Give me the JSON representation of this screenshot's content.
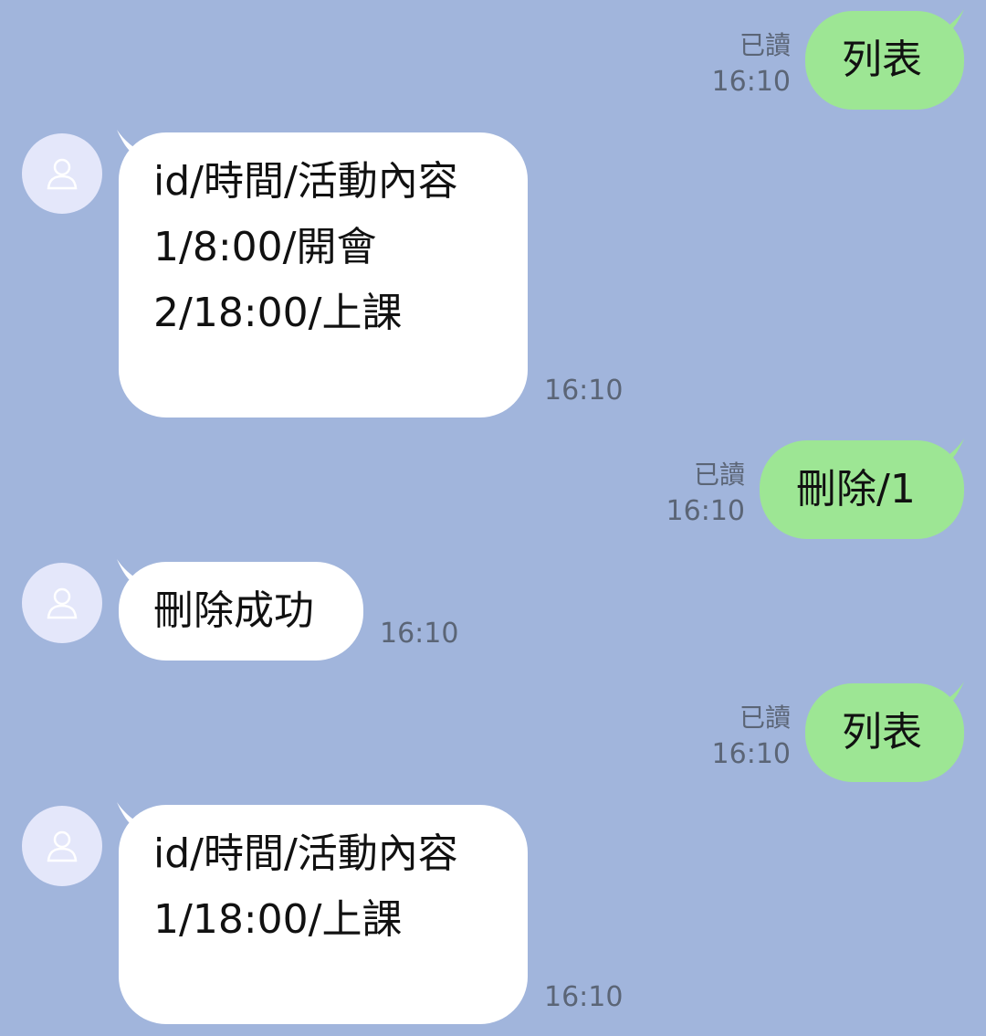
{
  "messages": [
    {
      "text": "列表",
      "read_label": "已讀",
      "time": "16:10"
    },
    {
      "text": "id/時間/活動內容\n1/8:00/開會\n2/18:00/上課",
      "time": "16:10"
    },
    {
      "text": "刪除/1",
      "read_label": "已讀",
      "time": "16:10"
    },
    {
      "text": "刪除成功",
      "time": "16:10"
    },
    {
      "text": "列表",
      "read_label": "已讀",
      "time": "16:10"
    },
    {
      "text": "id/時間/活動內容\n1/18:00/上課",
      "time": "16:10"
    }
  ],
  "colors": {
    "background": "#a1b5dc",
    "outgoing_bubble": "#9de694",
    "incoming_bubble": "#ffffff",
    "avatar_bg": "#e4e7fa",
    "meta_text": "#5b6576"
  },
  "icons": {
    "avatar": "user-silhouette-icon"
  }
}
